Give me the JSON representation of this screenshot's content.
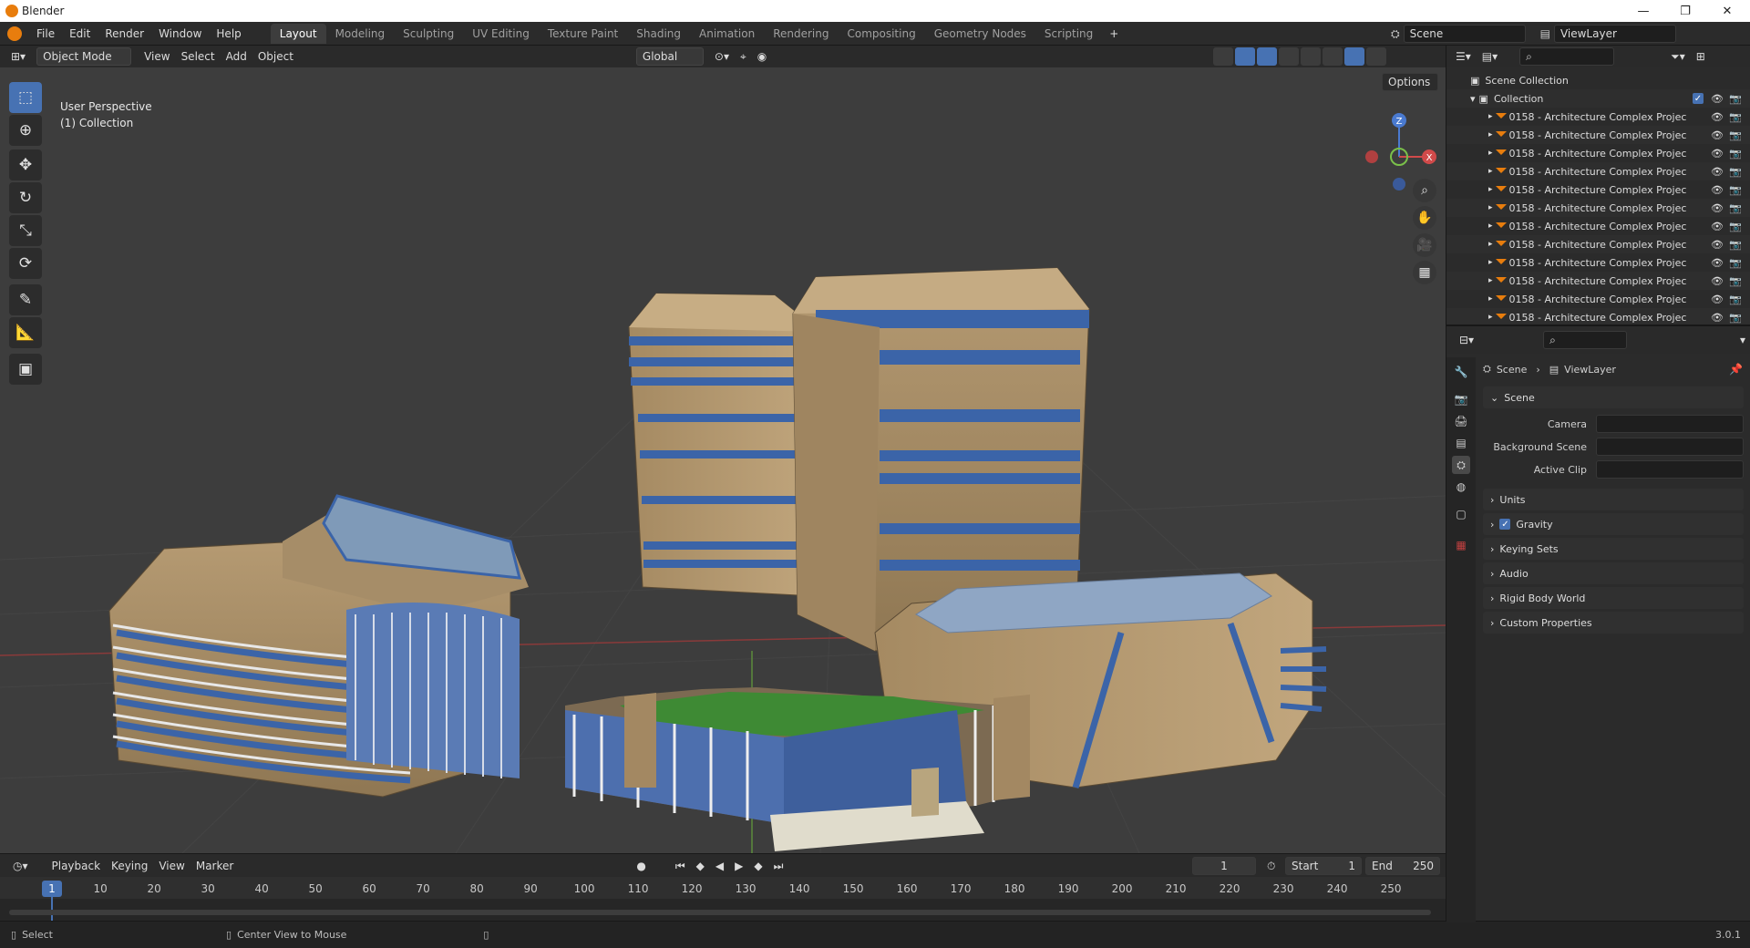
{
  "window": {
    "title": "Blender"
  },
  "menu": [
    "File",
    "Edit",
    "Render",
    "Window",
    "Help"
  ],
  "workspaces": [
    "Layout",
    "Modeling",
    "Sculpting",
    "UV Editing",
    "Texture Paint",
    "Shading",
    "Animation",
    "Rendering",
    "Compositing",
    "Geometry Nodes",
    "Scripting"
  ],
  "active_workspace": "Layout",
  "scene_field": "Scene",
  "viewlayer_field": "ViewLayer",
  "viewport_header": {
    "mode": "Object Mode",
    "menus": [
      "View",
      "Select",
      "Add",
      "Object"
    ],
    "orientation": "Global",
    "options": "Options"
  },
  "viewport_overlay": {
    "line1": "User Perspective",
    "line2": "(1) Collection"
  },
  "gizmo": {
    "z": "Z",
    "x": "X"
  },
  "outliner": {
    "root": "Scene Collection",
    "collection": "Collection",
    "items": [
      "0158 - Architecture Complex Projec",
      "0158 - Architecture Complex Projec",
      "0158 - Architecture Complex Projec",
      "0158 - Architecture Complex Projec",
      "0158 - Architecture Complex Projec",
      "0158 - Architecture Complex Projec",
      "0158 - Architecture Complex Projec",
      "0158 - Architecture Complex Projec",
      "0158 - Architecture Complex Projec",
      "0158 - Architecture Complex Projec",
      "0158 - Architecture Complex Projec",
      "0158 - Architecture Complex Projec"
    ]
  },
  "properties": {
    "breadcrumb_scene": "Scene",
    "breadcrumb_viewlayer": "ViewLayer",
    "panel_scene": "Scene",
    "camera_label": "Camera",
    "background_scene_label": "Background Scene",
    "active_clip_label": "Active Clip",
    "panels": [
      "Units",
      "Gravity",
      "Keying Sets",
      "Audio",
      "Rigid Body World",
      "Custom Properties"
    ]
  },
  "timeline": {
    "menus": [
      "Playback",
      "Keying",
      "View",
      "Marker"
    ],
    "current_frame": "1",
    "start_label": "Start",
    "start_value": "1",
    "end_label": "End",
    "end_value": "250",
    "frame_marks": [
      "1",
      "10",
      "20",
      "30",
      "40",
      "50",
      "60",
      "70",
      "80",
      "90",
      "100",
      "110",
      "120",
      "130",
      "140",
      "150",
      "160",
      "170",
      "180",
      "190",
      "200",
      "210",
      "220",
      "230",
      "240",
      "250"
    ]
  },
  "statusbar": {
    "select": "Select",
    "center_view": "Center View to Mouse",
    "version": "3.0.1"
  },
  "colors": {
    "accent": "#4772b3",
    "orange": "#e87d0d",
    "viewport_bg": "#3d3d3d"
  }
}
